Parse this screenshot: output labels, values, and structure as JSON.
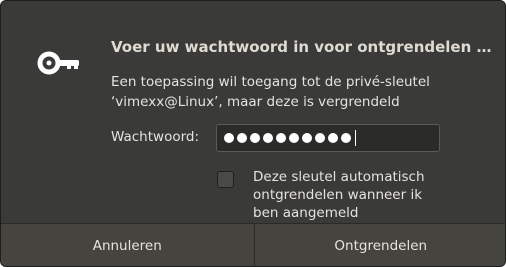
{
  "dialog": {
    "title": "Voer uw wachtwoord in voor ontgrendelen …",
    "description_line1": "Een toepassing wil toegang tot de privé-sleutel",
    "description_line2": "‘vimexx@Linux’, maar deze is vergrendeld",
    "icon": "key-icon"
  },
  "password": {
    "label": "Wachtwoord:",
    "masked_length": 10
  },
  "auto_unlock": {
    "checked": false,
    "label_line1": "Deze sleutel automatisch",
    "label_line2": "ontgrendelen wanneer ik",
    "label_line3": "ben aangemeld"
  },
  "buttons": {
    "cancel_label": "Annuleren",
    "unlock_label": "Ontgrendelen"
  }
}
